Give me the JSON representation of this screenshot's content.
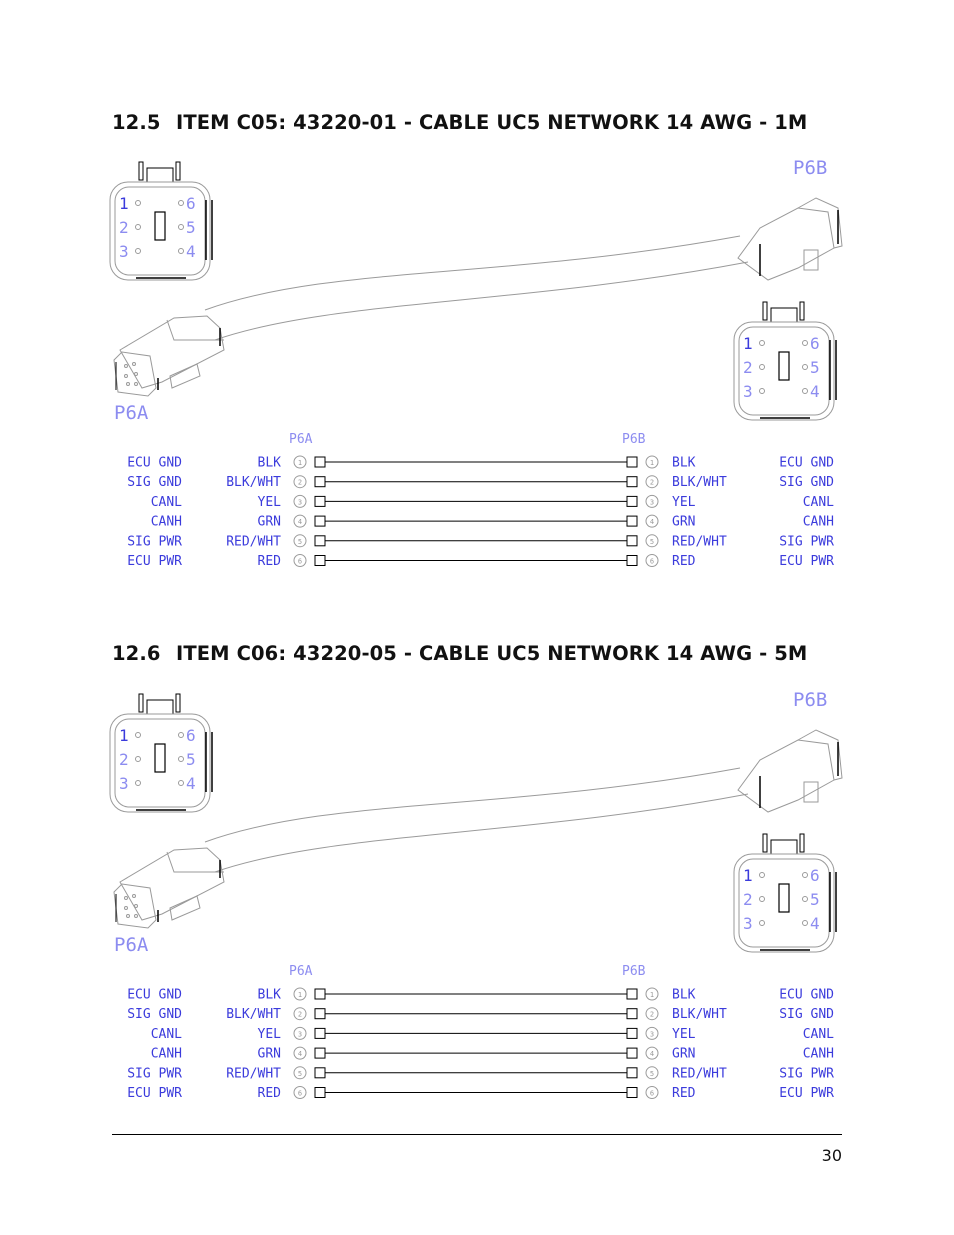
{
  "sections": [
    {
      "number": "12.5",
      "title": "ITEM C05: 43220-01 - CABLE UC5 NETWORK 14 AWG - 1M",
      "connector_a": "P6A",
      "connector_b": "P6B",
      "pin_face_labels": [
        "1",
        "2",
        "3",
        "4",
        "5",
        "6"
      ],
      "wiring": [
        {
          "pin": "1",
          "function_a": "ECU GND",
          "color_a": "BLK",
          "color_b": "BLK",
          "function_b": "ECU GND"
        },
        {
          "pin": "2",
          "function_a": "SIG GND",
          "color_a": "BLK/WHT",
          "color_b": "BLK/WHT",
          "function_b": "SIG GND"
        },
        {
          "pin": "3",
          "function_a": "CANL",
          "color_a": "YEL",
          "color_b": "YEL",
          "function_b": "CANL"
        },
        {
          "pin": "4",
          "function_a": "CANH",
          "color_a": "GRN",
          "color_b": "GRN",
          "function_b": "CANH"
        },
        {
          "pin": "5",
          "function_a": "SIG PWR",
          "color_a": "RED/WHT",
          "color_b": "RED/WHT",
          "function_b": "SIG PWR"
        },
        {
          "pin": "6",
          "function_a": "ECU PWR",
          "color_a": "RED",
          "color_b": "RED",
          "function_b": "ECU PWR"
        }
      ]
    },
    {
      "number": "12.6",
      "title": "ITEM C06: 43220-05 - CABLE UC5 NETWORK 14 AWG - 5M",
      "connector_a": "P6A",
      "connector_b": "P6B",
      "pin_face_labels": [
        "1",
        "2",
        "3",
        "4",
        "5",
        "6"
      ],
      "wiring": [
        {
          "pin": "1",
          "function_a": "ECU GND",
          "color_a": "BLK",
          "color_b": "BLK",
          "function_b": "ECU GND"
        },
        {
          "pin": "2",
          "function_a": "SIG GND",
          "color_a": "BLK/WHT",
          "color_b": "BLK/WHT",
          "function_b": "SIG GND"
        },
        {
          "pin": "3",
          "function_a": "CANL",
          "color_a": "YEL",
          "color_b": "YEL",
          "function_b": "CANL"
        },
        {
          "pin": "4",
          "function_a": "CANH",
          "color_a": "GRN",
          "color_b": "GRN",
          "function_b": "CANH"
        },
        {
          "pin": "5",
          "function_a": "SIG PWR",
          "color_a": "RED/WHT",
          "color_b": "RED/WHT",
          "function_b": "SIG PWR"
        },
        {
          "pin": "6",
          "function_a": "ECU PWR",
          "color_a": "RED",
          "color_b": "RED",
          "function_b": "ECU PWR"
        }
      ]
    }
  ],
  "colors": {
    "label_blue": "#3b3bdc",
    "label_blue_light": "#8c8cf0",
    "line_dark": "#000000",
    "line_gray": "#9a9a9a"
  },
  "footer": {
    "page_number": "30"
  }
}
